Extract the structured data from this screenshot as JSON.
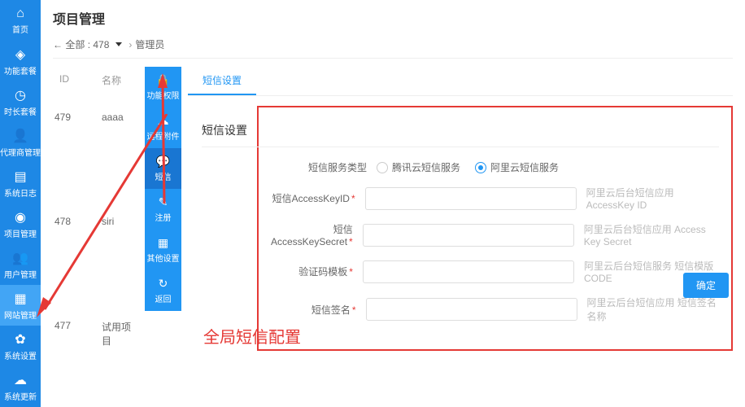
{
  "sidebar": {
    "items": [
      {
        "label": "首页",
        "icon": "⌂"
      },
      {
        "label": "功能套餐",
        "icon": "◈"
      },
      {
        "label": "时长套餐",
        "icon": "◷"
      },
      {
        "label": "代理商管理",
        "icon": "👤"
      },
      {
        "label": "系统日志",
        "icon": "▤"
      },
      {
        "label": "项目管理",
        "icon": "◉"
      },
      {
        "label": "用户管理",
        "icon": "👥"
      },
      {
        "label": "网站管理",
        "icon": "▦"
      },
      {
        "label": "系统设置",
        "icon": "✿"
      },
      {
        "label": "系统更新",
        "icon": "☁"
      }
    ],
    "active_index": 7
  },
  "page_title": "项目管理",
  "breadcrumb": {
    "all_label": "全部",
    "all_count": "478",
    "admin_label": "管理员"
  },
  "table": {
    "headers": {
      "id": "ID",
      "name": "名称"
    },
    "rows": [
      {
        "id": "479",
        "name": "aaaa"
      },
      {
        "id": "478",
        "name": "siri"
      },
      {
        "id": "477",
        "name": "试用项目"
      }
    ]
  },
  "action_menu": {
    "items": [
      {
        "label": "功能权限",
        "icon": "🔒"
      },
      {
        "label": "远程附件",
        "icon": "☁"
      },
      {
        "label": "短信",
        "icon": "💬"
      },
      {
        "label": "注册",
        "icon": "✎"
      },
      {
        "label": "其他设置",
        "icon": "▦"
      },
      {
        "label": "返回",
        "icon": "↻"
      }
    ],
    "active_index": 2
  },
  "tabs": {
    "items": [
      "短信设置"
    ],
    "selected": 0
  },
  "form": {
    "panel_title": "短信设置",
    "service_type": {
      "label": "短信服务类型",
      "options": [
        "腾讯云短信服务",
        "阿里云短信服务"
      ],
      "selected": 1
    },
    "fields": [
      {
        "label": "短信AccessKeyID",
        "help": "阿里云后台短信应用 AccessKey ID",
        "required": true
      },
      {
        "label": "短信AccessKeySecret",
        "help": "阿里云后台短信应用 Access Key Secret",
        "required": true
      },
      {
        "label": "验证码模板",
        "help": "阿里云后台短信服务 短信模版CODE",
        "required": true
      },
      {
        "label": "短信签名",
        "help": "阿里云后台短信应用 短信签名名称",
        "required": true
      }
    ]
  },
  "confirm_button": "确定",
  "caption_text": "全局短信配置"
}
